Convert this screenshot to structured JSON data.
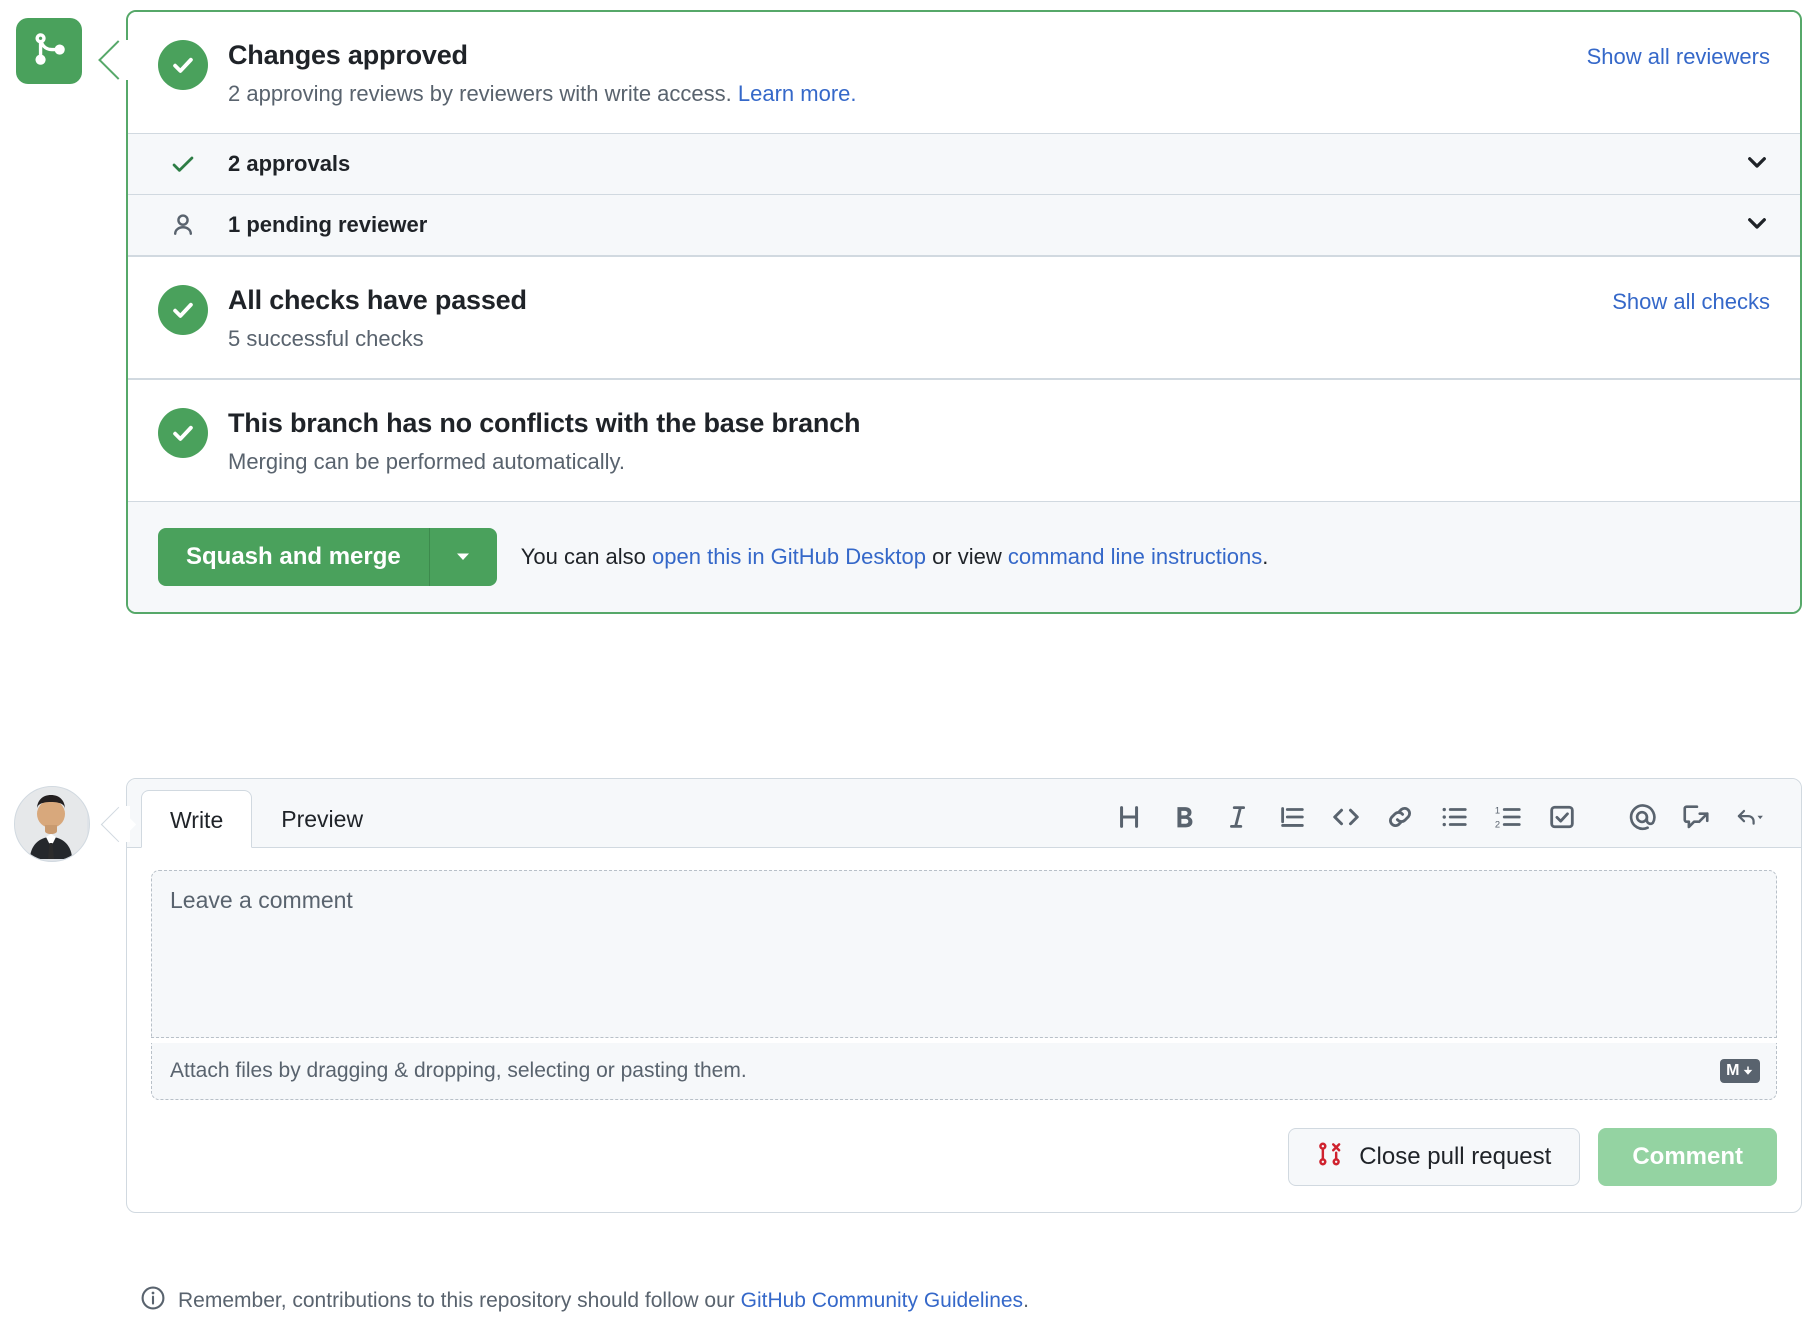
{
  "merge_panel": {
    "branch_icon": "git-merge-icon",
    "approved": {
      "icon": "check-circle-icon",
      "title": "Changes approved",
      "subtitle_prefix": "2 approving reviews by reviewers with write access.",
      "subtitle_link": "Learn more.",
      "right_link": "Show all reviewers"
    },
    "collapsibles": [
      {
        "icon": "check-icon",
        "label": "2 approvals",
        "chevron": "chevron-down-icon"
      },
      {
        "icon": "person-icon",
        "label": "1 pending reviewer",
        "chevron": "chevron-down-icon"
      }
    ],
    "checks": {
      "icon": "check-circle-icon",
      "title": "All checks have passed",
      "subtitle": "5 successful checks",
      "right_link": "Show all checks"
    },
    "conflicts": {
      "icon": "check-circle-icon",
      "title": "This branch has no conflicts with the base branch",
      "subtitle": "Merging can be performed automatically."
    },
    "actions": {
      "merge_label": "Squash and merge",
      "caret_icon": "triangle-down-icon",
      "alt_prefix": "You can also ",
      "alt_link1": "open this in GitHub Desktop",
      "alt_middle": " or view ",
      "alt_link2": "command line instructions",
      "alt_suffix": "."
    },
    "accent_green": "#4aa15c",
    "link_blue": "#3568c9"
  },
  "comment_editor": {
    "avatar": "user-avatar",
    "tabs": [
      {
        "label": "Write",
        "active": true
      },
      {
        "label": "Preview",
        "active": false
      }
    ],
    "toolbar": [
      {
        "name": "heading-icon"
      },
      {
        "name": "bold-icon"
      },
      {
        "name": "italic-icon"
      },
      {
        "name": "quote-icon"
      },
      {
        "name": "code-icon"
      },
      {
        "name": "link-icon"
      },
      {
        "name": "unordered-list-icon"
      },
      {
        "name": "ordered-list-icon"
      },
      {
        "name": "task-list-icon"
      },
      {
        "name": "mention-icon"
      },
      {
        "name": "saved-reply-icon"
      },
      {
        "name": "reply-icon"
      }
    ],
    "textarea": {
      "value": "",
      "placeholder": "Leave a comment"
    },
    "attach_text": "Attach files by dragging & dropping, selecting or pasting them.",
    "markdown_badge": "M",
    "close_button": {
      "icon": "pull-request-closed-icon",
      "label": "Close pull request"
    },
    "comment_button": {
      "label": "Comment",
      "disabled": true
    }
  },
  "footer": {
    "icon": "info-icon",
    "text_prefix": "Remember, contributions to this repository should follow our ",
    "link": "GitHub Community Guidelines",
    "text_suffix": "."
  }
}
